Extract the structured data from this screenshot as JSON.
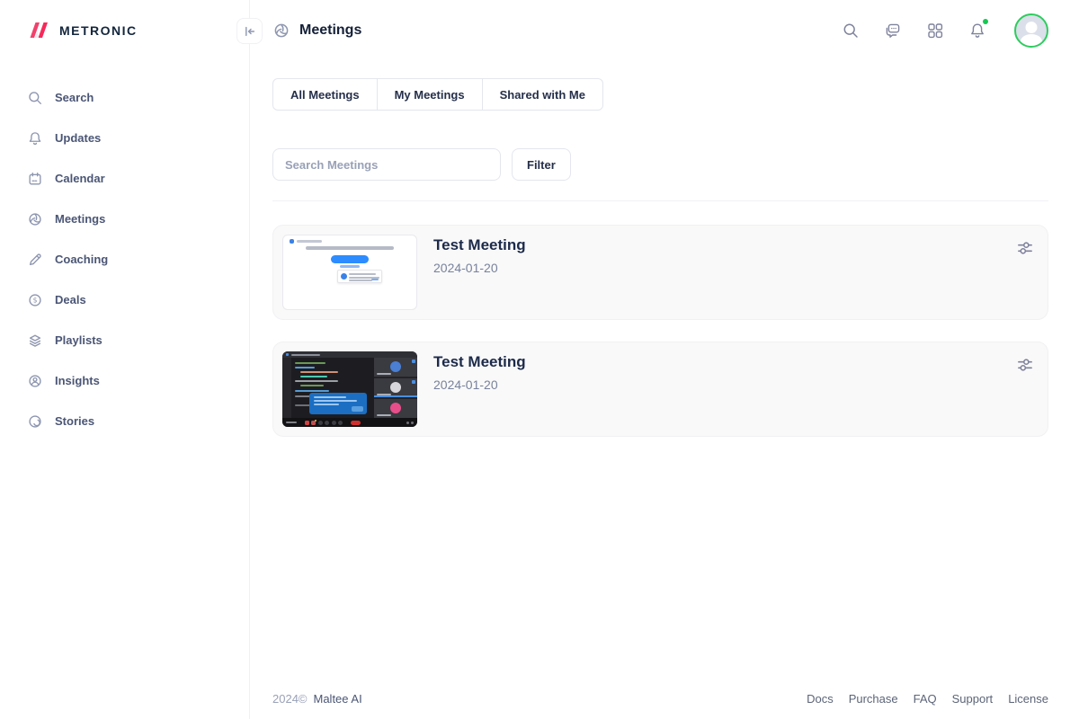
{
  "app": {
    "name": "METRONIC",
    "logo_icon": "metronic-logo-icon",
    "brand_color": "#f1416c"
  },
  "sidebar": {
    "collapse_icon": "collapse-sidebar-icon",
    "items": [
      {
        "label": "Search",
        "icon": "search-icon"
      },
      {
        "label": "Updates",
        "icon": "bell-icon"
      },
      {
        "label": "Calendar",
        "icon": "calendar-icon"
      },
      {
        "label": "Meetings",
        "icon": "aperture-icon"
      },
      {
        "label": "Coaching",
        "icon": "pencil-icon"
      },
      {
        "label": "Deals",
        "icon": "dollar-circle-icon"
      },
      {
        "label": "Playlists",
        "icon": "layers-icon"
      },
      {
        "label": "Insights",
        "icon": "person-circle-icon"
      },
      {
        "label": "Stories",
        "icon": "stories-circle-icon"
      }
    ]
  },
  "header": {
    "title": "Meetings",
    "title_icon": "aperture-icon",
    "action_icons": [
      "search-icon",
      "chat-icon",
      "apps-grid-icon",
      "notifications-bell-icon"
    ],
    "notification_dot_color": "#17c653",
    "avatar_ring_color": "#2ecc5e"
  },
  "tabs": [
    "All Meetings",
    "My Meetings",
    "Shared with Me"
  ],
  "filters": {
    "search_placeholder": "Search Meetings",
    "filter_label": "Filter"
  },
  "meetings": [
    {
      "title": "Test Meeting",
      "date": "2024-01-20",
      "thumbnail": "waiting-room-screenshot",
      "action_icon": "settings-sliders-icon"
    },
    {
      "title": "Test Meeting",
      "date": "2024-01-20",
      "thumbnail": "video-call-screenshot",
      "action_icon": "settings-sliders-icon"
    }
  ],
  "footer": {
    "year": "2024©",
    "company": "Maltee AI",
    "links": [
      "Docs",
      "Purchase",
      "FAQ",
      "Support",
      "License"
    ]
  }
}
